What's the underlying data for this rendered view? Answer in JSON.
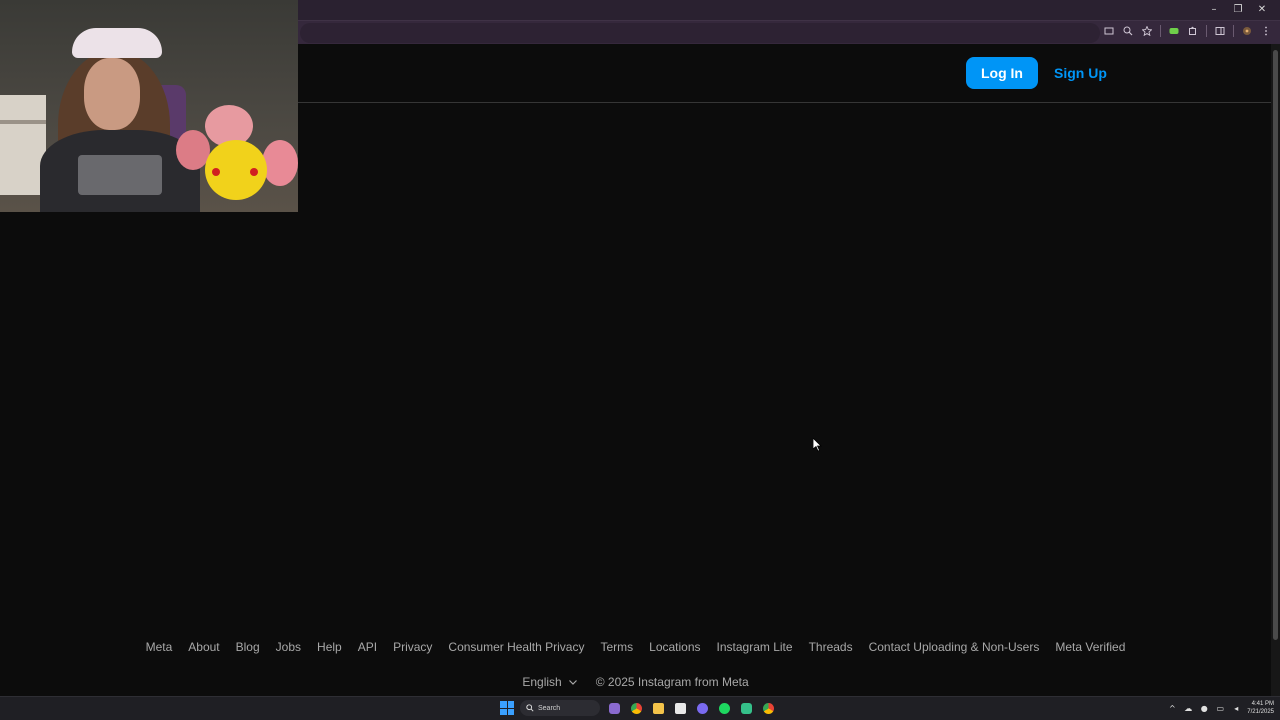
{
  "browser": {
    "window_controls": [
      "–",
      "❐",
      "✕"
    ],
    "toolbar_icons": [
      "cast-icon",
      "zoom-icon",
      "bookmark-star-icon",
      "extension-green-icon",
      "extensions-puzzle-icon",
      "sidebar-icon",
      "profile-icon",
      "menu-kebab-icon"
    ]
  },
  "header": {
    "login_label": "Log In",
    "signup_label": "Sign Up"
  },
  "footer": {
    "links": [
      "Meta",
      "About",
      "Blog",
      "Jobs",
      "Help",
      "API",
      "Privacy",
      "Consumer Health Privacy",
      "Terms",
      "Locations",
      "Instagram Lite",
      "Threads",
      "Contact Uploading & Non-Users",
      "Meta Verified"
    ],
    "language": "English",
    "copyright": "© 2025 Instagram from Meta"
  },
  "taskbar": {
    "search_placeholder": "Search",
    "time": "4:41 PM",
    "date": "7/21/2025"
  },
  "colors": {
    "page_bg": "#0c0c0c",
    "accent": "#0095f6",
    "footer_text": "#a8a8a8"
  }
}
